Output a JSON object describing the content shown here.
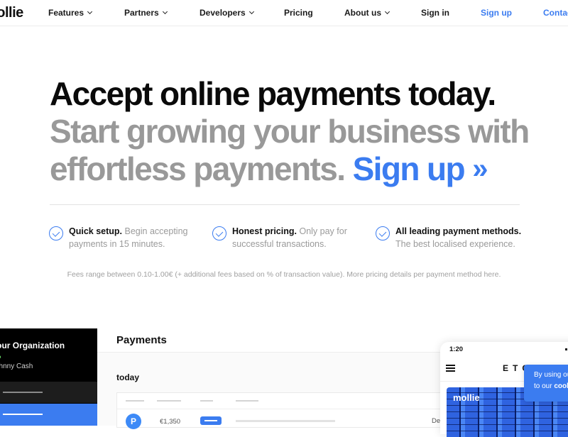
{
  "nav": {
    "logo": "mollie",
    "items": [
      {
        "label": "Features",
        "dropdown": true
      },
      {
        "label": "Partners",
        "dropdown": true
      },
      {
        "label": "Developers",
        "dropdown": true
      },
      {
        "label": "Pricing",
        "dropdown": false
      },
      {
        "label": "About us",
        "dropdown": true
      },
      {
        "label": "Sign in",
        "dropdown": false
      },
      {
        "label": "Sign up",
        "dropdown": false
      },
      {
        "label": "Contact",
        "dropdown": false
      }
    ]
  },
  "hero": {
    "headline": "Accept online payments today.",
    "subline_1": "Start growing your business with",
    "subline_2": "effortless payments.",
    "cta": "Sign up",
    "cta_icon": "»"
  },
  "features": [
    {
      "title": "Quick setup.",
      "text": "Begin accepting payments in 15 minutes."
    },
    {
      "title": "Honest pricing.",
      "text": "Only pay for successful transactions."
    },
    {
      "title": "All leading payment methods.",
      "text": "The best localised experience."
    }
  ],
  "fees_note": "Fees range between 0.10-1.00€ (+ additional fees based on % of transaction value). More pricing details per payment method here.",
  "dashboard": {
    "sidebar": {
      "org": "Your Organization",
      "status_dot": "●",
      "user": "Johnny Cash"
    },
    "title": "Payments",
    "section": "today",
    "rows": [
      {
        "method_icon": "P",
        "amount": "€1,350",
        "date": "De"
      }
    ]
  },
  "phone": {
    "time": "1:20",
    "brand": "ETC",
    "banner_logo": "mollie"
  },
  "cookie": {
    "line1": "By using our",
    "line2_prefix": "to our ",
    "line2_bold": "cookie"
  },
  "colors": {
    "accent": "#3b7cf0",
    "headline": "#0a0a0a",
    "muted": "#999999"
  }
}
